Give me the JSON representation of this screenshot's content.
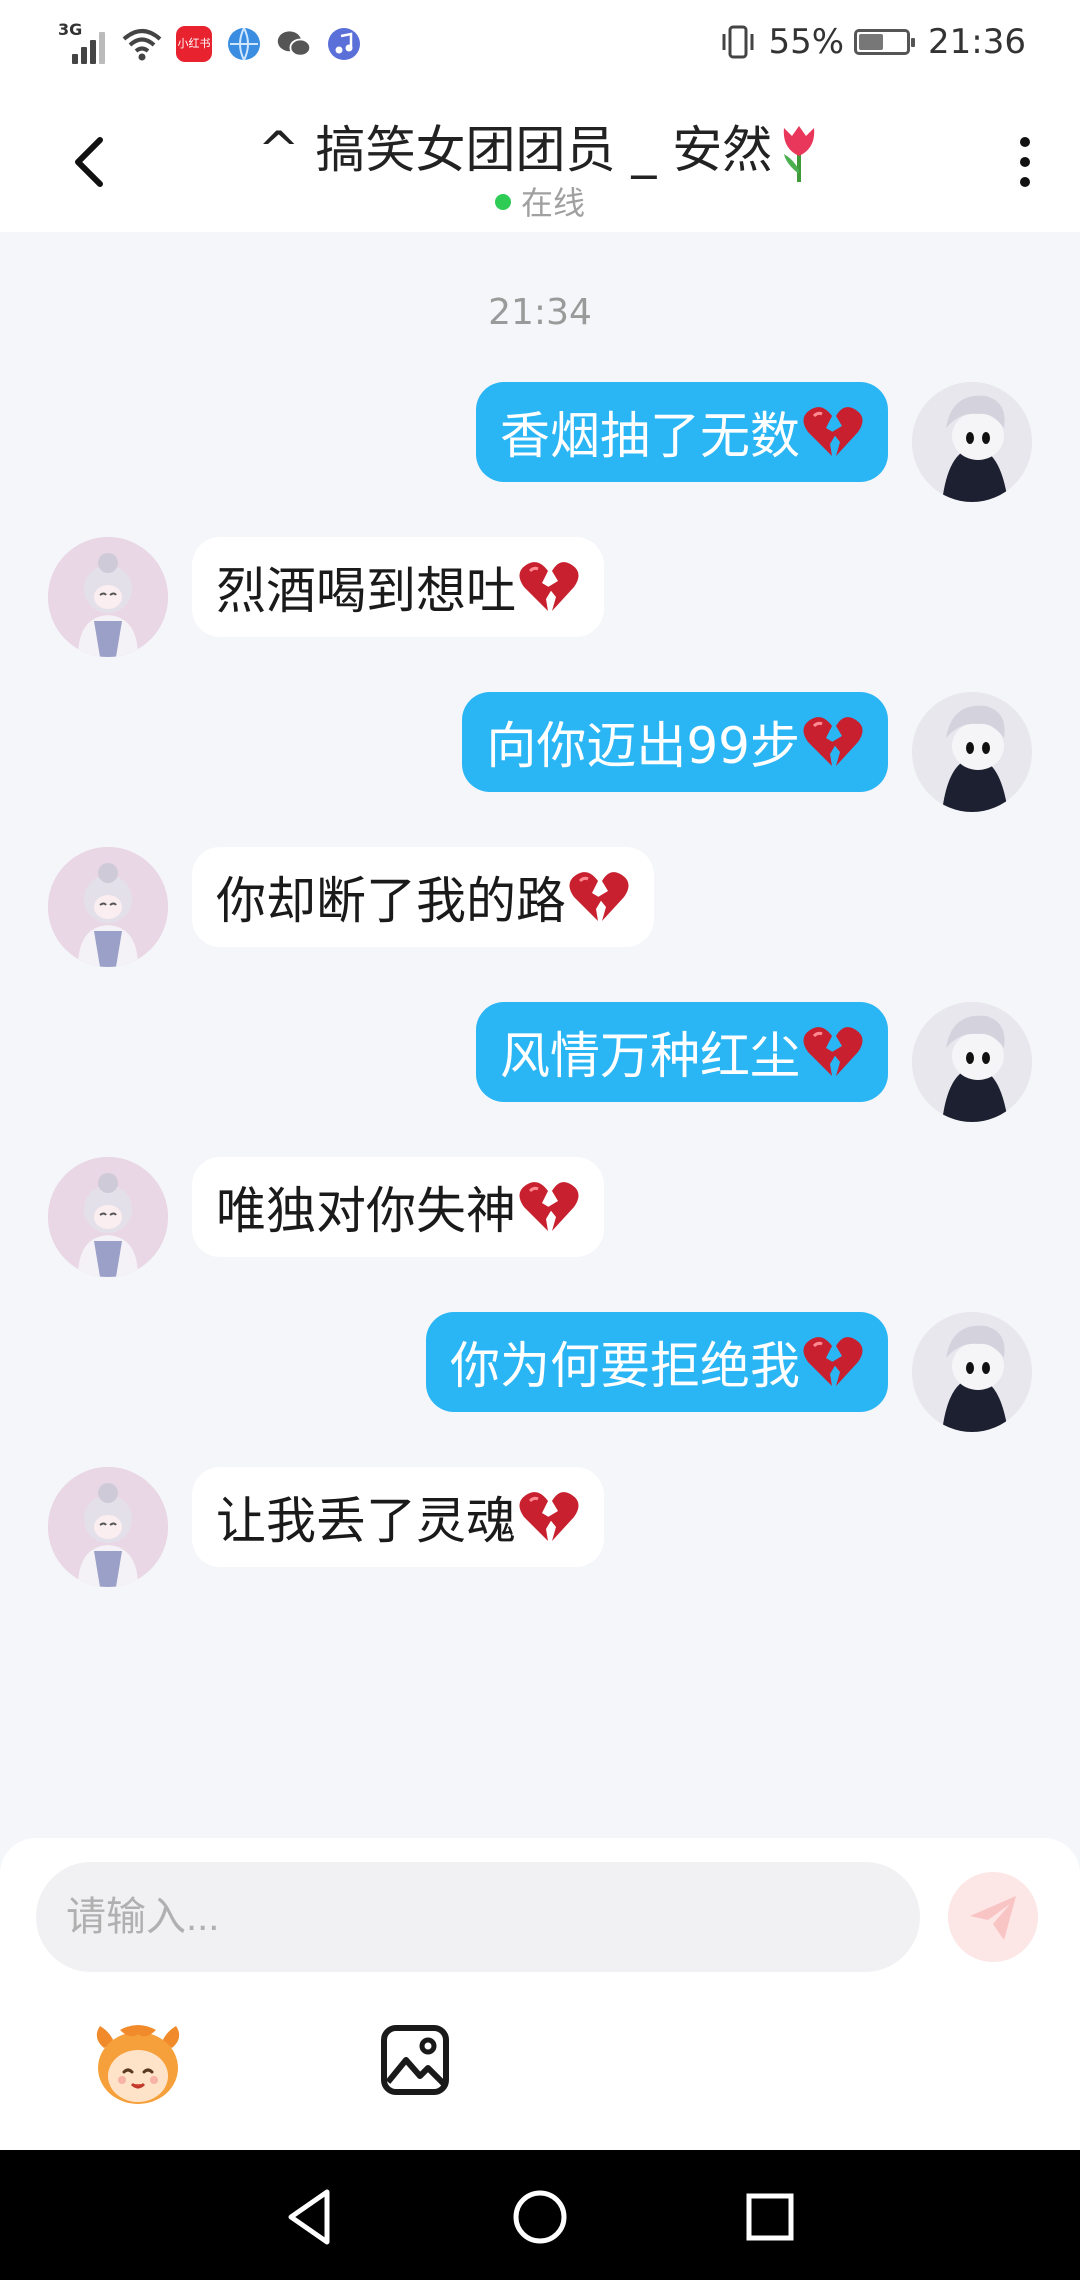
{
  "status_bar": {
    "network": "3G",
    "app_badge": "小红书",
    "battery_percent": 55,
    "battery": "55%",
    "time": "21:36",
    "icons": [
      "signal-icon",
      "wifi-icon",
      "xiaohongshu-app-icon",
      "browser-icon",
      "wechat-icon",
      "music-icon",
      "vibrate-icon",
      "battery-icon"
    ]
  },
  "header": {
    "title": "^ 搞笑女团团员 _ 安然",
    "title_emoji": "tulip-emoji",
    "status": "在线",
    "status_color": "#2ecc55"
  },
  "chat": {
    "timestamp": "21:34",
    "messages": [
      {
        "sender": "me",
        "text": "香烟抽了无数",
        "emoji": "broken-heart"
      },
      {
        "sender": "peer",
        "text": "烈酒喝到想吐",
        "emoji": "broken-heart"
      },
      {
        "sender": "me",
        "text": "向你迈出99步",
        "emoji": "broken-heart"
      },
      {
        "sender": "peer",
        "text": "你却断了我的路",
        "emoji": "broken-heart"
      },
      {
        "sender": "me",
        "text": "风情万种红尘",
        "emoji": "broken-heart"
      },
      {
        "sender": "peer",
        "text": "唯独对你失神",
        "emoji": "broken-heart"
      },
      {
        "sender": "me",
        "text": "你为何要拒绝我",
        "emoji": "broken-heart"
      },
      {
        "sender": "peer",
        "text": "让我丢了灵魂",
        "emoji": "broken-heart"
      }
    ]
  },
  "composer": {
    "placeholder": "请输入...",
    "value": "",
    "tools": [
      "emoji-sticker-icon",
      "image-picker-icon"
    ]
  },
  "colors": {
    "outgoing_bubble": "#2ab5f4",
    "incoming_bubble": "#ffffff",
    "background": "#f4f6f9"
  }
}
